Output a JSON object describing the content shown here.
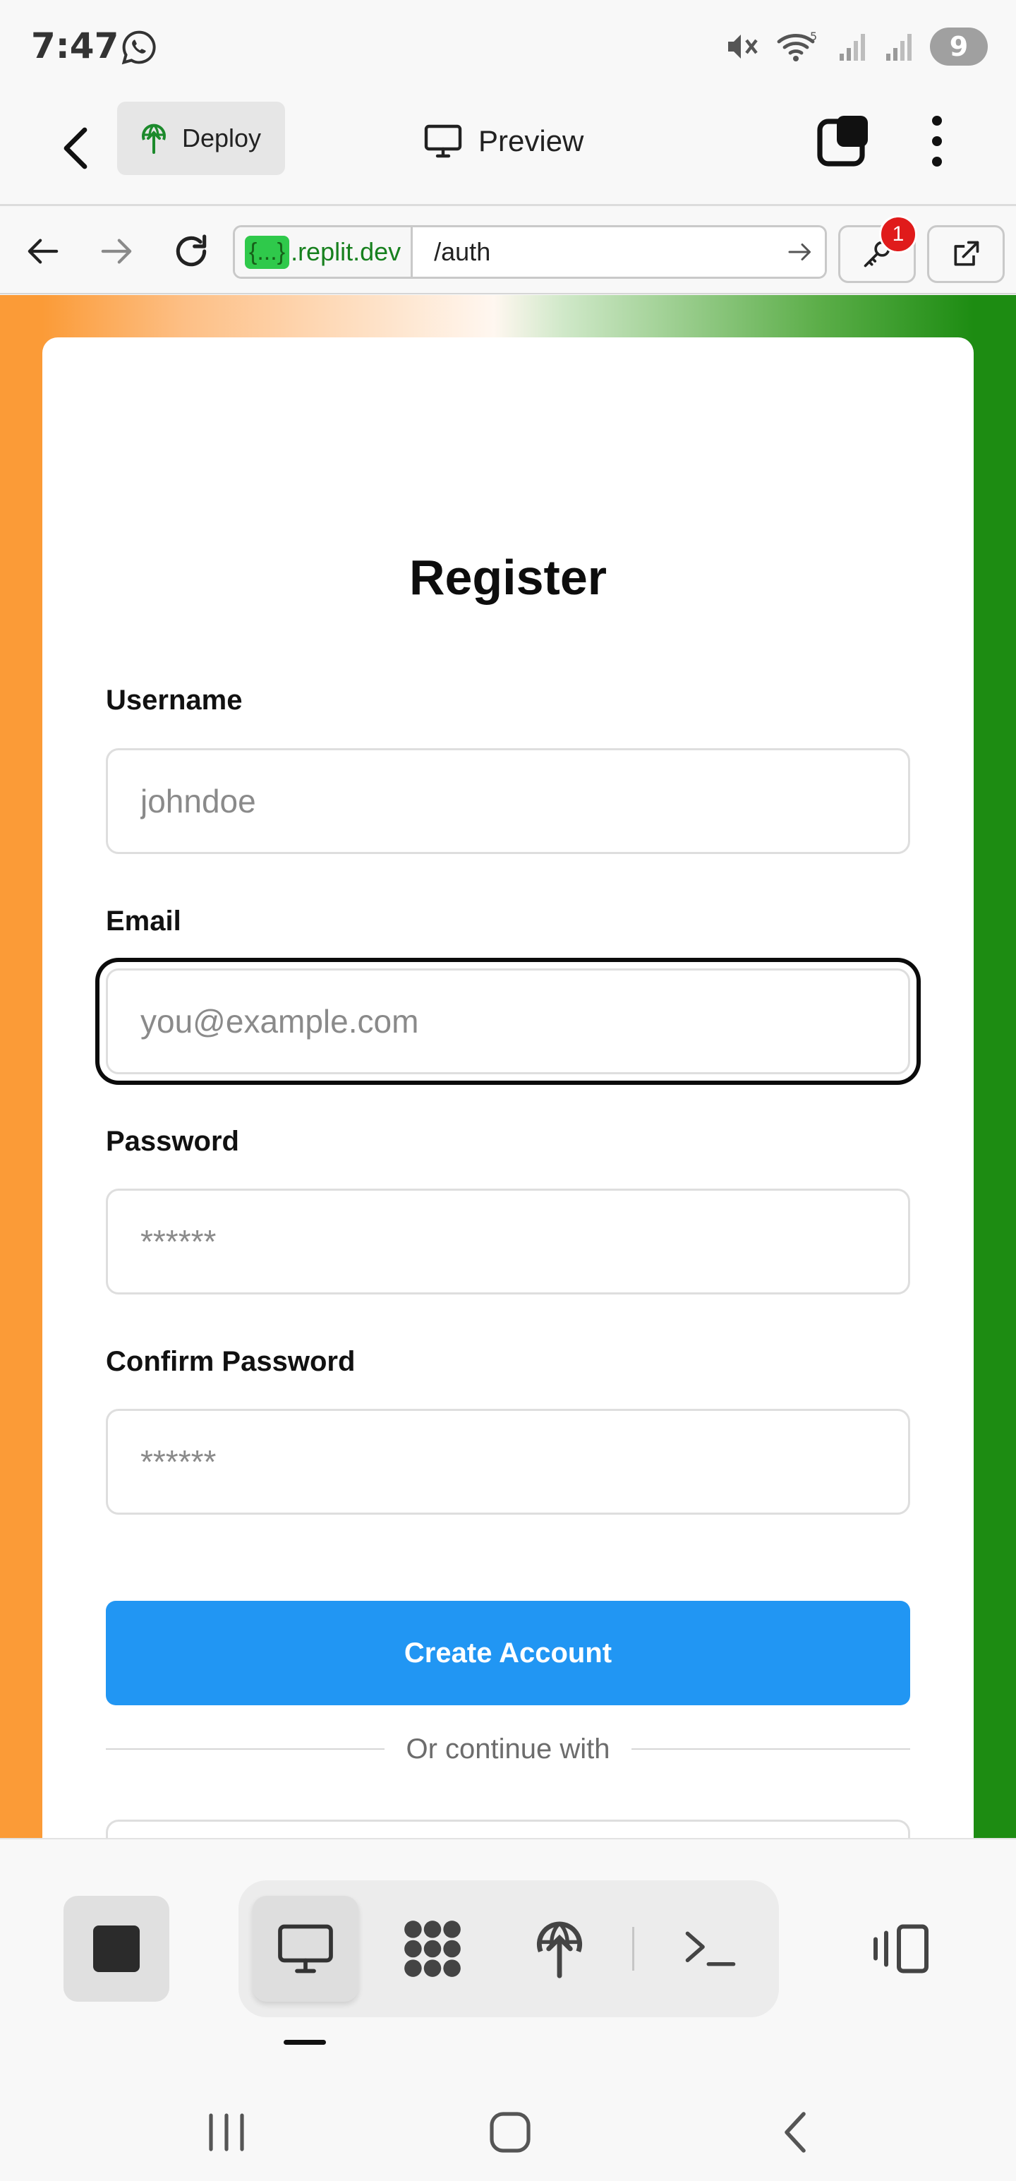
{
  "status_bar": {
    "time": "7:47",
    "battery": "9",
    "icons": [
      "whatsapp-icon",
      "mute-icon",
      "wifi-icon",
      "signal-icon",
      "signal-icon"
    ]
  },
  "toolbar": {
    "deploy_label": "Deploy",
    "preview_label": "Preview"
  },
  "browser": {
    "host_pill": "{...}",
    "host_suffix": ".replit.dev",
    "path": "/auth",
    "key_badge": "1"
  },
  "page": {
    "title": "Register",
    "fields": {
      "username": {
        "label": "Username",
        "placeholder": "johndoe"
      },
      "email": {
        "label": "Email",
        "placeholder": "you@example.com"
      },
      "password": {
        "label": "Password",
        "placeholder": "******"
      },
      "confirm": {
        "label": "Confirm Password",
        "placeholder": "******"
      }
    },
    "submit_label": "Create Account",
    "divider_text": "Or continue with"
  },
  "bottom_bar": {
    "tools": [
      "monitor-icon",
      "apps-icon",
      "deploy-icon",
      "terminal-icon"
    ],
    "active_tool": "monitor-icon"
  },
  "colors": {
    "primary": "#2196f3",
    "gradient_left": "#fb9b37",
    "gradient_right": "#1d8c12",
    "badge": "#e01b1b"
  }
}
